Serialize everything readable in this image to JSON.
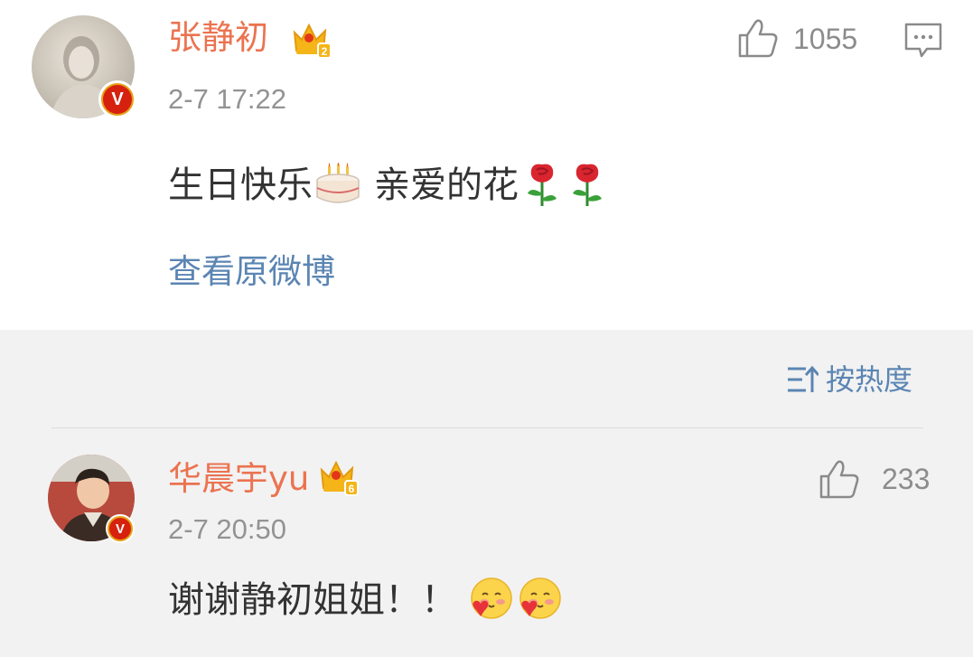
{
  "post": {
    "author": "张静初",
    "time": "2-7 17:22",
    "text_main": "生日快乐",
    "text_after": "亲爱的花",
    "likes": "1055",
    "view_original": "查看原微博",
    "vip_level": "2",
    "verified_badge": "V"
  },
  "sort": {
    "label": "按热度"
  },
  "comments": [
    {
      "author": "华晨宇yu",
      "time": "2-7 20:50",
      "text": "谢谢静初姐姐！！",
      "likes": "233",
      "vip_level": "6",
      "verified_badge": "V"
    }
  ],
  "colors": {
    "name": "#eb7350",
    "link": "#5b85b3",
    "meta": "#939393",
    "text": "#333333",
    "background": "#f2f2f2"
  }
}
